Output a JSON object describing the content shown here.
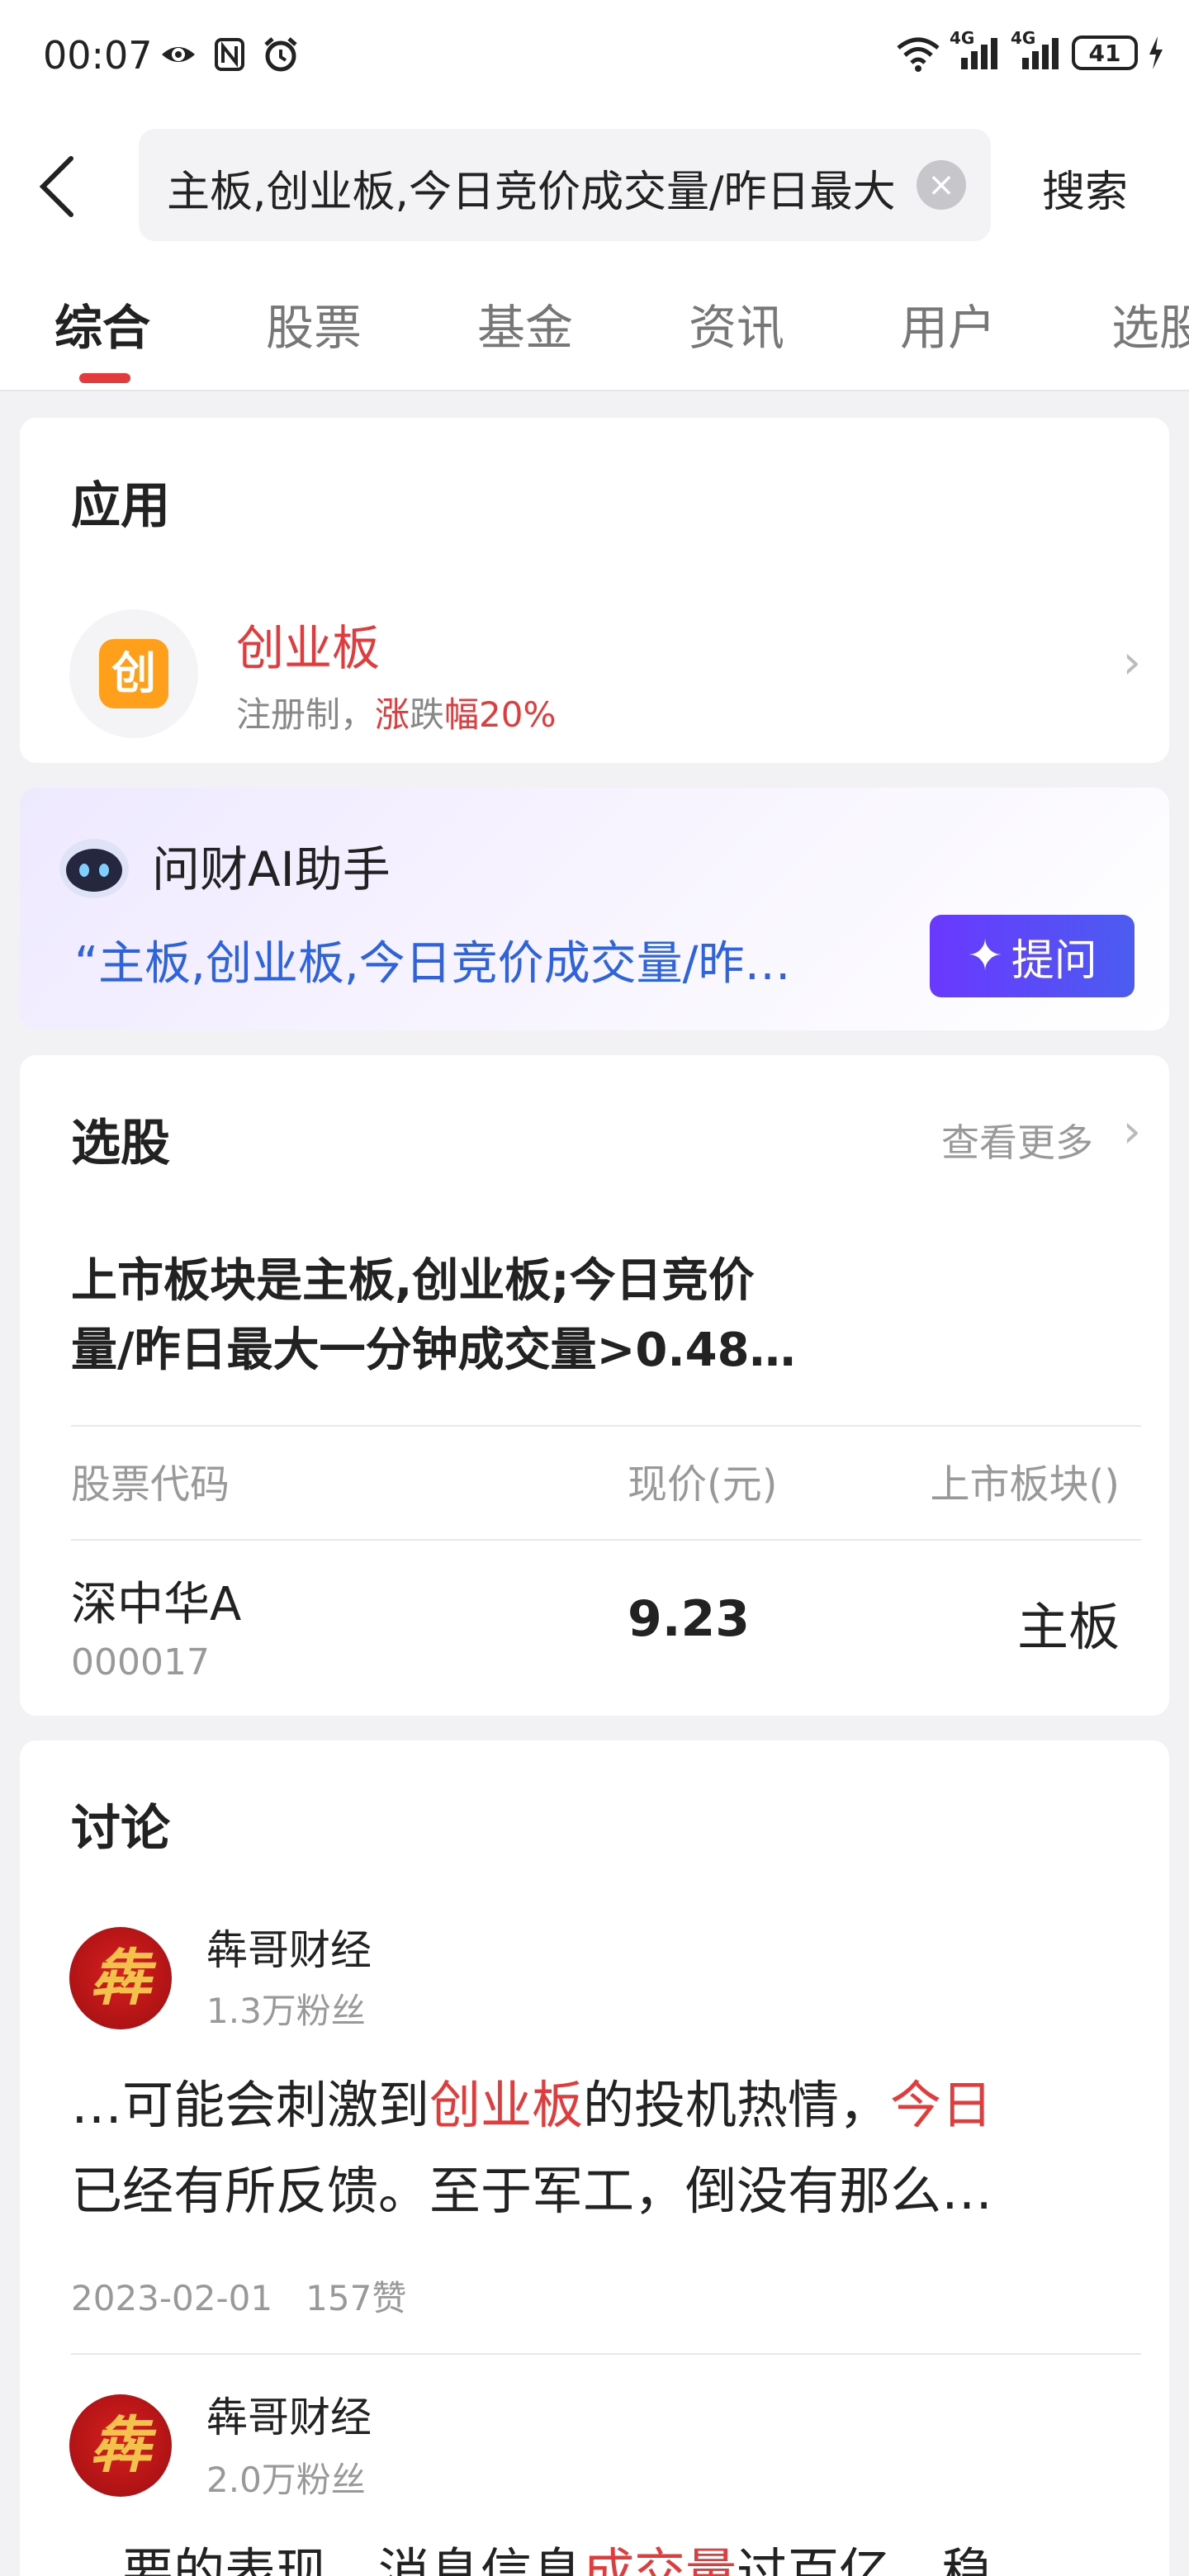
{
  "status_bar": {
    "time": "00:07",
    "network_left": "4G",
    "network_right": "4G",
    "battery": "41",
    "icons": [
      "eye-icon",
      "nfc-icon",
      "alarm-icon",
      "wifi-icon",
      "signal-icon",
      "charging-icon"
    ]
  },
  "search": {
    "query": "主板,创业板,今日竞价成交量/昨日最大一分钟成交量",
    "button": "搜索"
  },
  "tabs": [
    "综合",
    "股票",
    "基金",
    "资讯",
    "用户",
    "选股"
  ],
  "app_section": {
    "title": "应用",
    "app_name": "创业板",
    "icon_char": "创",
    "desc_prefix": "注册制，",
    "desc_red1": "涨",
    "desc_mid": "跌",
    "desc_red2": "幅20%"
  },
  "ai": {
    "title": "问财AI助手",
    "query": "“主板,创业板,今日竞价成交量/昨…",
    "ask_label": "提问"
  },
  "stock_pick": {
    "title": "选股",
    "more": "查看更多",
    "query_line1": "上市板块是主板,创业板;今日竞价",
    "query_line2": "量/昨日最大一分钟成交量>0.48…",
    "col_code": "股票代码",
    "col_price": "现价(元)",
    "col_board": "上市板块()",
    "rows": [
      {
        "name": "深中华A",
        "code": "000017",
        "price": "9.23",
        "board": "主板"
      }
    ]
  },
  "discussion": {
    "title": "讨论",
    "posts": [
      {
        "author": "犇哥财经",
        "avatar_char": "犇",
        "fans": "1.3万粉丝",
        "text_a": "…可能会刺激到",
        "text_hl1": "创业板",
        "text_b": "的投机热情，",
        "text_hl2": "今日",
        "line2": "已经有所反馈。至于军工，倒没有那么…",
        "date": "2023-02-01",
        "likes": "157赞"
      },
      {
        "author": "犇哥财经",
        "avatar_char": "犇",
        "fans": "2.0万粉丝",
        "text_a": "…要的表现，消息信息",
        "text_hl1": "成交量",
        "text_b": "过百亿，稳"
      }
    ]
  }
}
